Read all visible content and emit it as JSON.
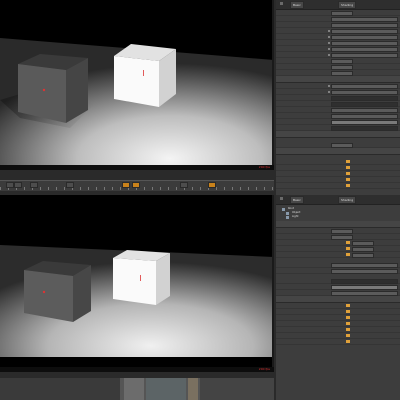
{
  "viewport_top": {
    "status_text": "200 fps"
  },
  "viewport_bottom": {
    "status_text": "200 fps"
  },
  "panel_top": {
    "tabs": [
      "Basic",
      "Shading"
    ]
  },
  "panel_bottom": {
    "tree_items": [
      "Root",
      "Object",
      "Light"
    ],
    "tabs": [
      "Basic",
      "Shading"
    ]
  },
  "colors": {
    "accent_orange": "#c9821b",
    "selected_orange": "#e0a13a",
    "status_red": "#d33",
    "viewport_bg": "#000000",
    "panel_bg": "#3d3d3d"
  },
  "icons": {
    "cube_left": "cube-icon",
    "cube_right": "cube-icon"
  }
}
